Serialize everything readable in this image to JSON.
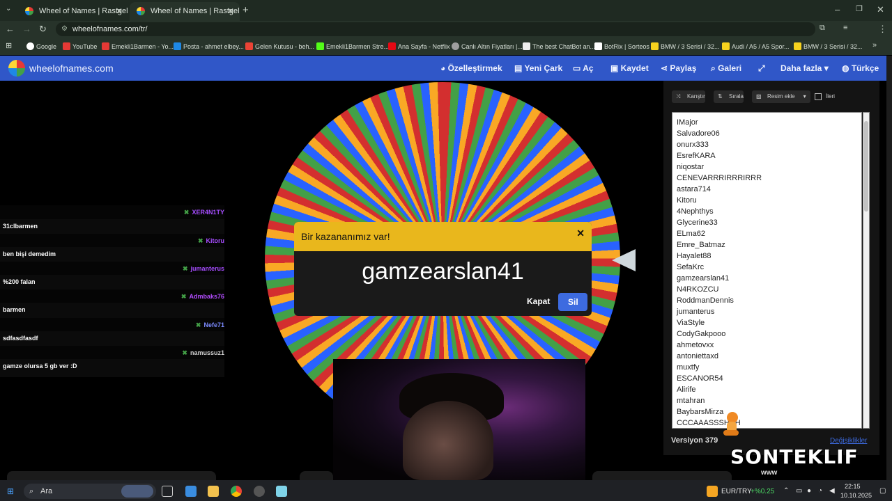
{
  "browser": {
    "tabs": [
      {
        "title": "Wheel of Names | Rastgele ad seçici",
        "active": false
      },
      {
        "title": "Wheel of Names | Rastgele ad seçici",
        "active": true
      }
    ],
    "url": "wheelofnames.com/tr/",
    "bookmarks": [
      "Google",
      "YouTube",
      "Emekli1Barmen - Yo...",
      "Posta - ahmet elbey...",
      "Gelen Kutusu - beh...",
      "Emekli1Barmen Stre...",
      "Ana Sayfa - Netflix",
      "Canlı Altın Fiyatları |...",
      "The best ChatBot an...",
      "BotRix | Sorteos",
      "BMW / 3 Serisi / 32...",
      "Audi / A5 / A5 Spor...",
      "BMW / 3 Serisi / 32..."
    ]
  },
  "site": {
    "logo": "wheelofnames.com",
    "nav": [
      "Özelleştirmek",
      "Yeni Çark",
      "Aç",
      "Kaydet",
      "Paylaş",
      "Galeri",
      "Daha fazla",
      "Türkçe"
    ]
  },
  "chat": [
    {
      "user": "XER4N1TY",
      "color": "#a64dff",
      "message": "31clbarmen"
    },
    {
      "user": "Kitoru",
      "color": "#a64dff",
      "message": "ben bişi demedim"
    },
    {
      "user": "jumanterus",
      "color": "#a64dff",
      "message": "%200 falan"
    },
    {
      "user": "Admbaks76",
      "color": "#b34dff",
      "message": "barmen"
    },
    {
      "user": "Nefe71",
      "color": "#7c8bff",
      "message": "sdfasdfasdf"
    },
    {
      "user": "namussuz1",
      "color": "#d0d0d0",
      "message": "gamze olursa 5 gb ver :D"
    }
  ],
  "modal": {
    "title": "Bir kazananımız var!",
    "winner": "gamzearslan41",
    "close_label": "Kapat",
    "delete_label": "Sil"
  },
  "panel": {
    "shuffle": "Karıştır",
    "sort": "Sırala",
    "add_image": "Resim ekle",
    "advanced": "İleri",
    "entries": [
      "IMajor",
      "Salvadore06",
      "onurx333",
      "EsrefKARA",
      "niqostar",
      "CENEVARRRIRRRIRRR",
      "astara714",
      "Kitoru",
      "4Nephthys",
      "Glycerine33",
      "ELma62",
      "Emre_Batmaz",
      "Hayalet88",
      "SefaKrc",
      "gamzearslan41",
      "N4RKOZCU",
      "RoddmanDennis",
      "jumanterus",
      "ViaStyle",
      "CodyGakpooo",
      "ahmetovxx",
      "antoniettaxd",
      "muxtfy",
      "ESCANOR54",
      "Alirife",
      "mtahran",
      "BaybarsMirza",
      "CCCAAASSSHHH"
    ],
    "version": "Versiyon 379",
    "changes": "Değişiklikler"
  },
  "overlay": {
    "brand": "SONTEKLIF",
    "brand_sub": "www"
  },
  "taskbar": {
    "search": "Ara",
    "currency": "EUR/TRY",
    "currency_change": "+%0.25",
    "time": "22:15",
    "date": "10.10.2025"
  }
}
